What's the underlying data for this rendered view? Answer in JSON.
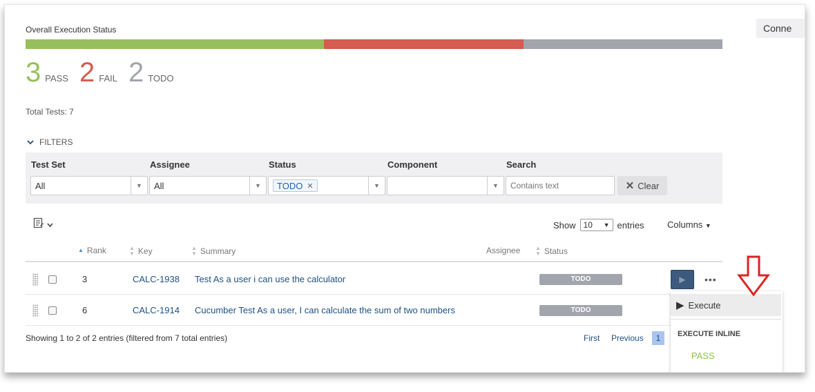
{
  "header": {
    "title": "Overall Execution Status",
    "connect_label": "Conne"
  },
  "progress": {
    "segments": [
      {
        "status": "PASS",
        "count": 3,
        "color": "#97c05c"
      },
      {
        "status": "FAIL",
        "count": 2,
        "color": "#d45c50"
      },
      {
        "status": "TODO",
        "count": 2,
        "color": "#a2a5ac"
      }
    ]
  },
  "counts": {
    "pass": {
      "num": "3",
      "label": "PASS",
      "color": "#97c05c"
    },
    "fail": {
      "num": "2",
      "label": "FAIL",
      "color": "#d45c50"
    },
    "todo": {
      "num": "2",
      "label": "TODO",
      "color": "#a2a5ac"
    }
  },
  "total_tests": "Total Tests: 7",
  "filters": {
    "toggle_label": "FILTERS",
    "test_set": {
      "label": "Test Set",
      "value": "All"
    },
    "assignee": {
      "label": "Assignee",
      "value": "All"
    },
    "status": {
      "label": "Status",
      "tag": "TODO"
    },
    "component": {
      "label": "Component",
      "value": ""
    },
    "search": {
      "label": "Search",
      "placeholder": "Contains text"
    },
    "clear_label": "Clear"
  },
  "table_controls": {
    "show_label": "Show",
    "show_value": "10",
    "entries_label": "entries",
    "columns_label": "Columns"
  },
  "table": {
    "headers": {
      "rank": "Rank",
      "key": "Key",
      "summary": "Summary",
      "assignee": "Assignee",
      "status": "Status"
    },
    "rows": [
      {
        "rank": "3",
        "key": "CALC-1938",
        "summary": "Test As a user i can use the calculator",
        "assignee": "",
        "status": "TODO"
      },
      {
        "rank": "6",
        "key": "CALC-1914",
        "summary": "Cucumber Test As a user, I can calculate the sum of two numbers",
        "assignee": "",
        "status": "TODO"
      }
    ]
  },
  "footer": {
    "info": "Showing 1 to 2 of 2 entries (filtered from 7 total entries)",
    "first": "First",
    "previous": "Previous",
    "page": "1"
  },
  "dropdown": {
    "execute": "Execute",
    "execute_inline": "EXECUTE INLINE",
    "pass": "PASS"
  },
  "annotation": {
    "arrow_color": "#e02020"
  }
}
